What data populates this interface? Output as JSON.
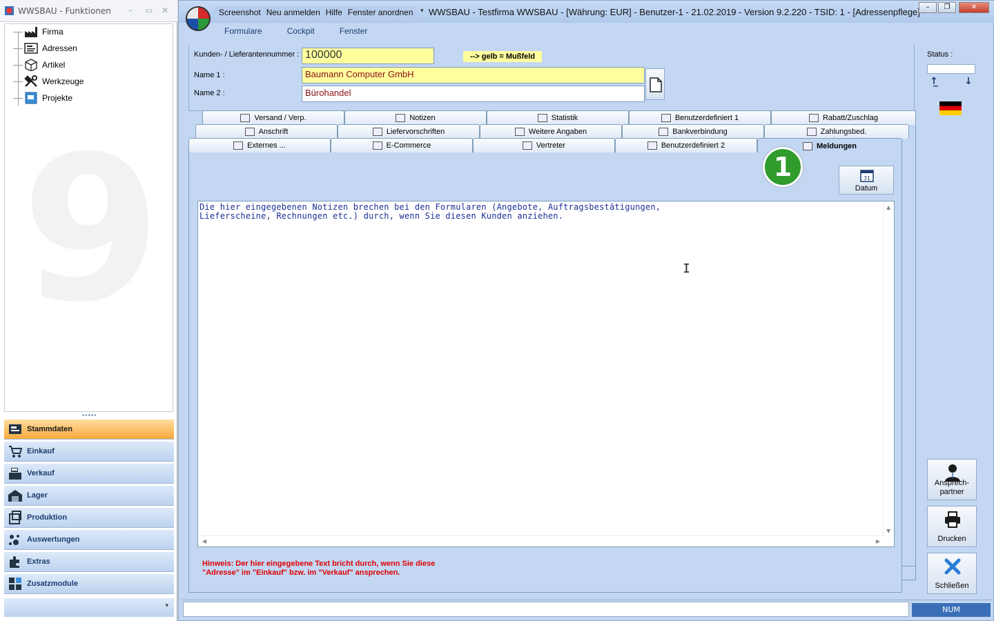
{
  "left_window": {
    "title": "WWSBAU - Funktionen",
    "tree": [
      {
        "label": "Firma",
        "icon": "factory-icon"
      },
      {
        "label": "Adressen",
        "icon": "address-card-icon"
      },
      {
        "label": "Artikel",
        "icon": "box-icon"
      },
      {
        "label": "Werkzeuge",
        "icon": "tools-icon"
      },
      {
        "label": "Projekte",
        "icon": "project-icon"
      }
    ],
    "nav": [
      {
        "label": "Stammdaten",
        "active": true
      },
      {
        "label": "Einkauf"
      },
      {
        "label": "Verkauf"
      },
      {
        "label": "Lager"
      },
      {
        "label": "Produktion"
      },
      {
        "label": "Auswertungen"
      },
      {
        "label": "Extras"
      },
      {
        "label": "Zusatzmodule"
      }
    ],
    "watermark": "9"
  },
  "main_window": {
    "quick_menu": [
      "Screenshot",
      "Neu anmelden",
      "Hilfe",
      "Fenster anordnen"
    ],
    "caption": "WWSBAU - Testfirma WWSBAU - [Währung: EUR] - Benutzer-1 - 21.02.2019 - Version 9.2.220 - TSID: 1  - [Adressenpflege]",
    "menu": [
      "Formulare",
      "Cockpit",
      "Fenster"
    ]
  },
  "form": {
    "kundennr_label": "Kunden- / Lieferantennummer :",
    "kundennr_value": "100000",
    "legend": "--> gelb = Mußfeld",
    "name1_label": "Name 1 :",
    "name1_value": "Baumann Computer GmbH",
    "name2_label": "Name 2 :",
    "name2_value": "Bürohandel"
  },
  "right_panel": {
    "status_label": "Status :",
    "ansprech_line1": "Ansprech-",
    "ansprech_line2": "partner",
    "drucken": "Drucken",
    "schliessen": "Schließen"
  },
  "tabs": {
    "row1": [
      "Versand / Verp.",
      "Notizen",
      "Statistik",
      "Benutzerdefiniert 1",
      "Rabatt/Zuschlag"
    ],
    "row2": [
      "Anschrift",
      "Liefervorschriften",
      "Weitere Angaben",
      "Bankverbindung",
      "Zahlungsbed."
    ],
    "row3": [
      "Externes ...",
      "E-Commerce",
      "Vertreter",
      "Benutzerdefiniert 2",
      "Meldungen"
    ]
  },
  "content": {
    "badge": "1",
    "datum_label": "Datum",
    "calendar_day": "31",
    "memo_text": "Die hier eingegebenen Notizen brechen bei den Formularen (Angebote, Auftragsbestätigungen,\nLieferscheine, Rechnungen etc.) durch, wenn Sie diesen Kunden anziehen.",
    "hint": "Hinweis: Der hier eingegebene Text bricht durch, wenn Sie diese\n\"Adresse\" im \"Einkauf\" bzw. im \"Verkauf\" ansprechen."
  },
  "statusbar": {
    "num": "NUM"
  },
  "colors": {
    "required_field": "#ffff9e",
    "badge": "#2f9c2b",
    "hint": "#e00000",
    "active_nav": "#f7a93c"
  }
}
